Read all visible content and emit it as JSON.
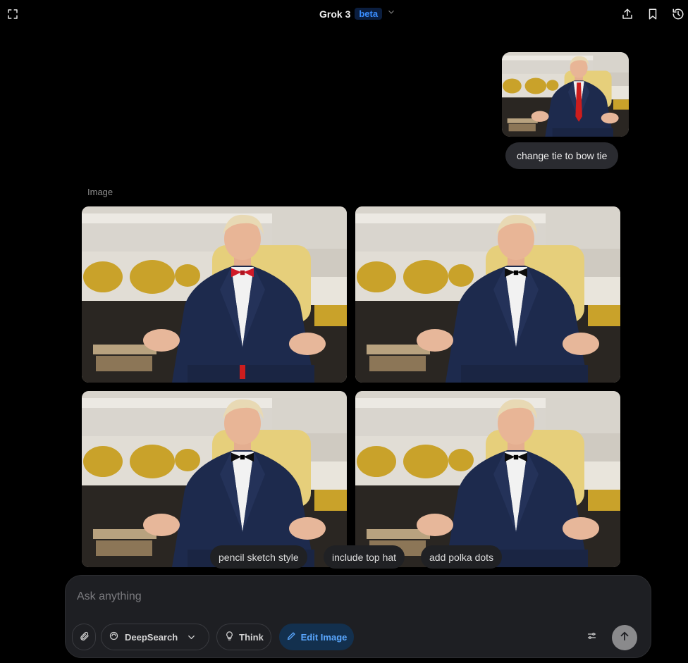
{
  "header": {
    "title": "Grok 3",
    "badge": "beta",
    "icons": [
      "expand-icon",
      "chevron-down-icon",
      "share-icon",
      "bookmark-icon",
      "history-icon"
    ]
  },
  "conversation": {
    "user_message": "change tie to bow tie",
    "response_label": "Image",
    "generated_images": [
      {
        "tie": "red-bow-tie"
      },
      {
        "tie": "black-bow-tie"
      },
      {
        "tie": "black-bow-tie"
      },
      {
        "tie": "black-bow-tie"
      }
    ]
  },
  "suggestions": [
    "pencil sketch style",
    "include top hat",
    "add polka dots"
  ],
  "composer": {
    "placeholder": "Ask anything",
    "deepsearch_label": "DeepSearch",
    "think_label": "Think",
    "edit_image_label": "Edit Image"
  },
  "colors": {
    "background": "#000000",
    "composer_bg": "#1e1f23",
    "accent": "#3a8dff",
    "edit_active_bg": "#13304e"
  }
}
